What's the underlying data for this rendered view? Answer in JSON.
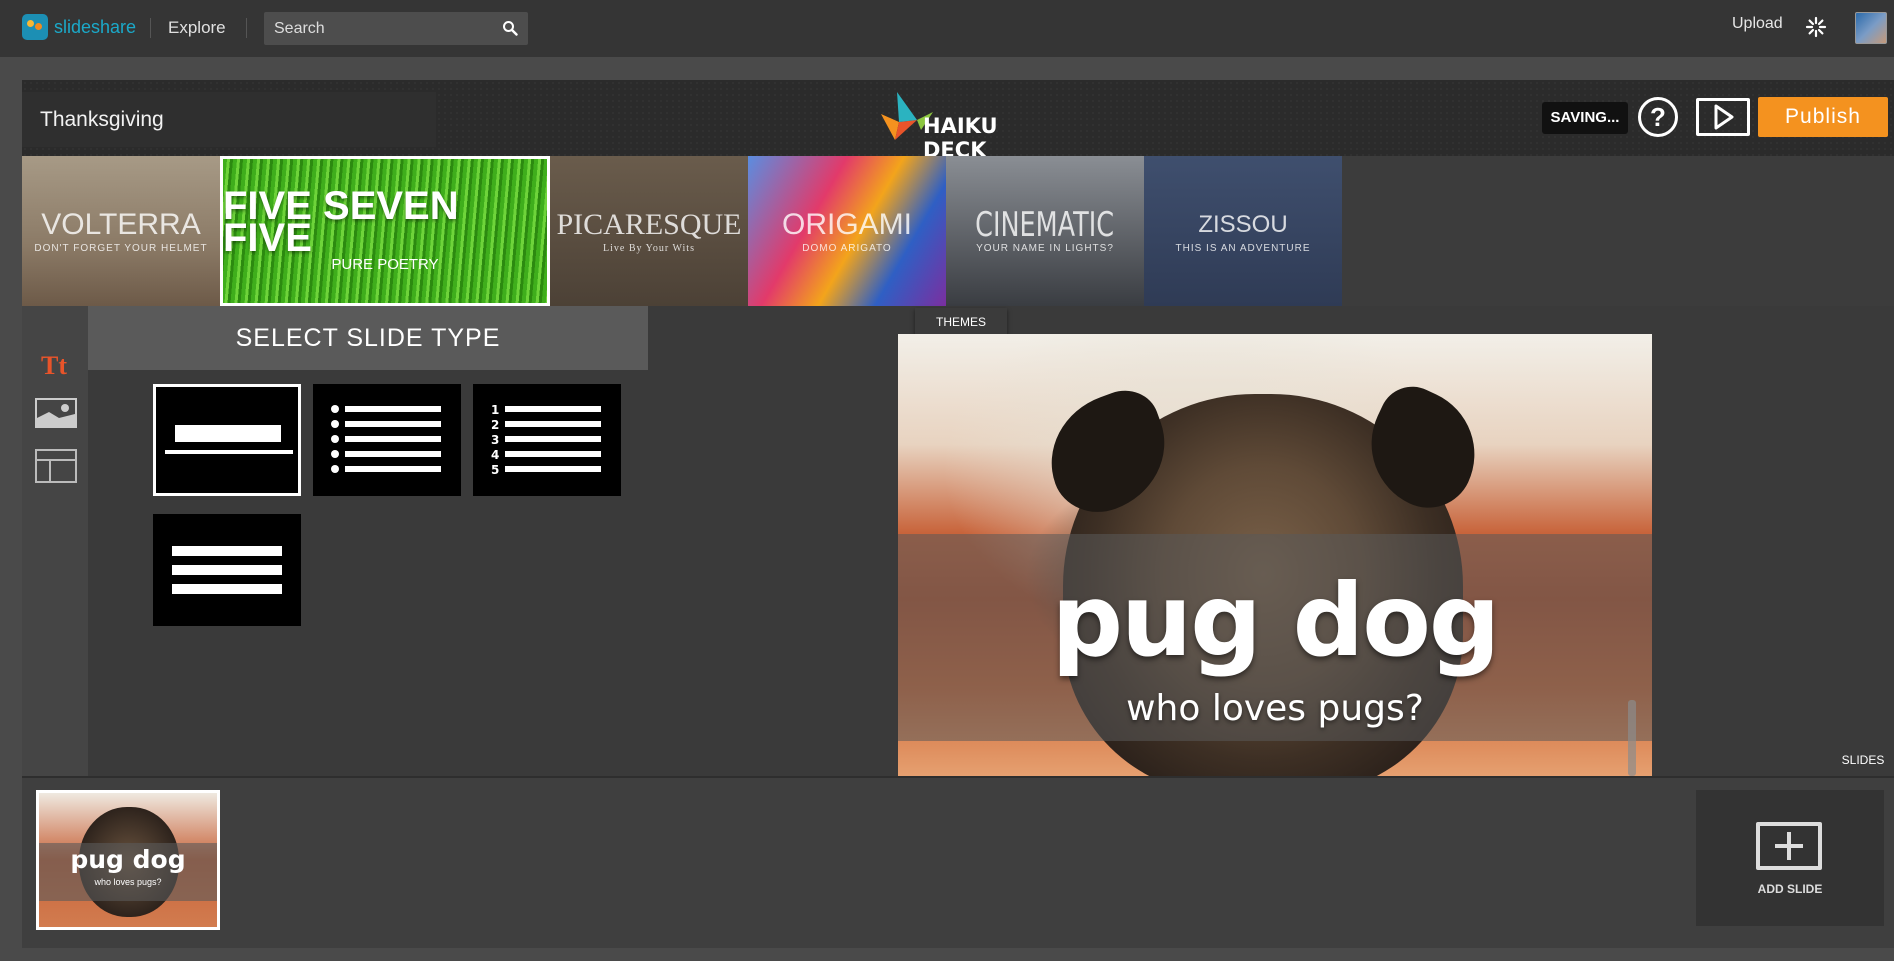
{
  "topbar": {
    "brand": "slideshare",
    "explore": "Explore",
    "search_placeholder": "Search",
    "upload": "Upload"
  },
  "header": {
    "deck_title": "Thanksgiving",
    "logo_text": "HAIKU DECK",
    "saving": "SAVING...",
    "help": "?",
    "publish": "Publish"
  },
  "themes": [
    {
      "title": "VOLTERRA",
      "subtitle": "DON'T FORGET YOUR HELMET"
    },
    {
      "title": "FIVE SEVEN FIVE",
      "subtitle": "PURE POETRY"
    },
    {
      "title": "PICARESQUE",
      "subtitle": "Live By Your Wits"
    },
    {
      "title": "ORIGAMI",
      "subtitle": "DOMO ARIGATO"
    },
    {
      "title": "CINEMATIC",
      "subtitle": "YOUR NAME IN LIGHTS?"
    },
    {
      "title": "ZISSOU",
      "subtitle": "THIS IS AN ADVENTURE"
    }
  ],
  "panel": {
    "title": "SELECT SLIDE TYPE",
    "numbers": [
      "1",
      "2",
      "3",
      "4",
      "5"
    ]
  },
  "tabs": {
    "themes": "THEMES",
    "slides": "SLIDES"
  },
  "slide": {
    "title": "pug dog",
    "subtitle": "who loves pugs?"
  },
  "strip": {
    "thumb_title": "pug dog",
    "thumb_subtitle": "who loves pugs?",
    "add_slide": "ADD SLIDE"
  },
  "colors": {
    "accent": "#f4921f",
    "text_tool": "#e8542a",
    "brand": "#1ba9c9"
  }
}
